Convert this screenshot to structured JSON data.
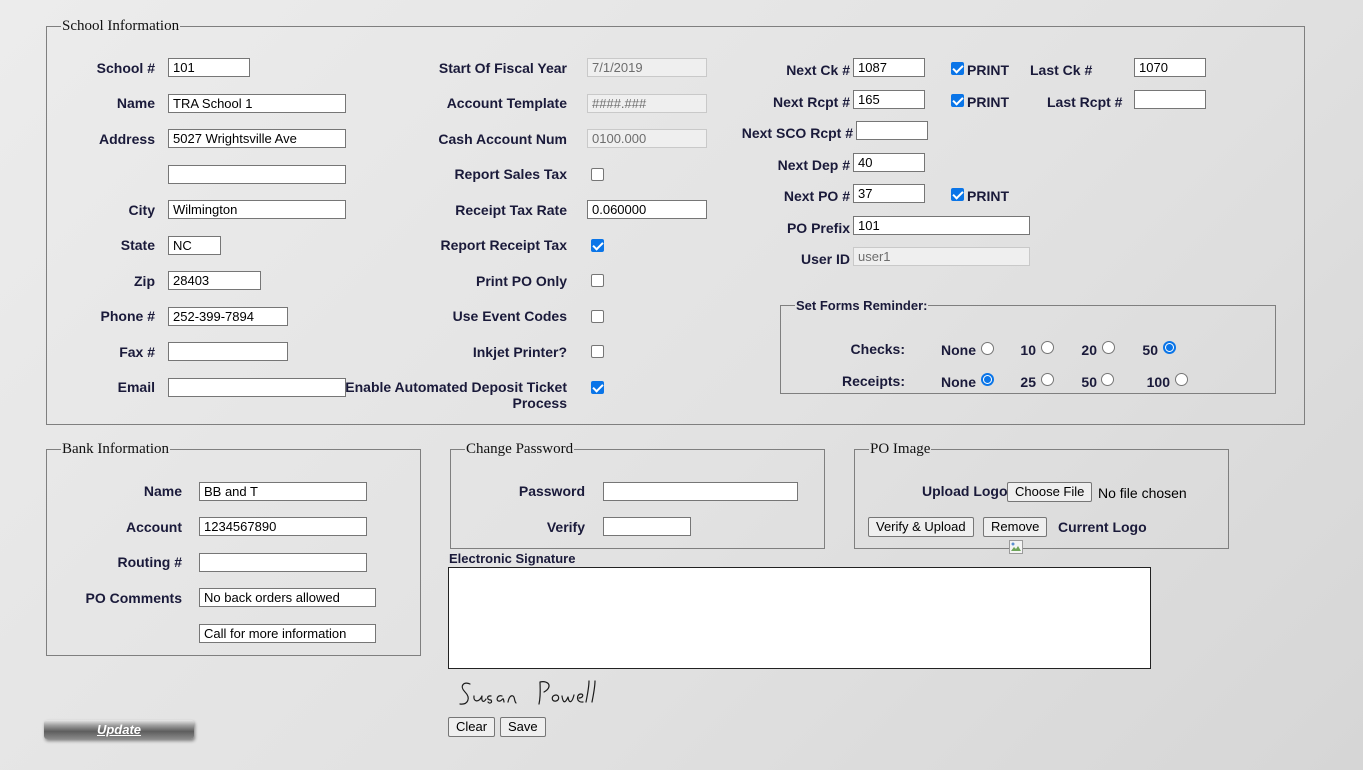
{
  "school": {
    "legend": "School Information",
    "labels": {
      "school_num": "School #",
      "name": "Name",
      "address": "Address",
      "city": "City",
      "state": "State",
      "zip": "Zip",
      "phone": "Phone #",
      "fax": "Fax #",
      "email": "Email"
    },
    "values": {
      "school_num": "101",
      "name": "TRA School 1",
      "address1": "5027 Wrightsville Ave",
      "address2": "",
      "city": "Wilmington",
      "state": "NC",
      "zip": "28403",
      "phone": "252-399-7894",
      "fax": "",
      "email": ""
    }
  },
  "fiscal": {
    "labels": {
      "start_fiscal": "Start Of Fiscal Year",
      "account_template": "Account Template",
      "cash_account": "Cash Account Num",
      "report_sales_tax": "Report Sales Tax",
      "receipt_tax_rate": "Receipt Tax Rate",
      "report_receipt_tax": "Report Receipt Tax",
      "print_po_only": "Print PO Only",
      "use_event_codes": "Use Event Codes",
      "inkjet_printer": "Inkjet Printer?",
      "enable_deposit_1": "Enable Automated Deposit Ticket",
      "enable_deposit_2": "Process"
    },
    "values": {
      "start_fiscal": "7/1/2019",
      "account_template": "####.###",
      "cash_account": "0100.000",
      "receipt_tax_rate": "0.060000"
    },
    "checks": {
      "report_sales_tax": false,
      "report_receipt_tax": true,
      "print_po_only": false,
      "use_event_codes": false,
      "inkjet_printer": false,
      "enable_deposit": true
    }
  },
  "numbers": {
    "labels": {
      "next_ck": "Next Ck #",
      "next_rcpt": "Next Rcpt #",
      "next_sco_rcpt": "Next SCO Rcpt #",
      "next_dep": "Next Dep #",
      "next_po": "Next PO #",
      "po_prefix": "PO Prefix",
      "user_id": "User ID",
      "last_ck": "Last Ck #",
      "last_rcpt": "Last Rcpt #",
      "print": "PRINT"
    },
    "values": {
      "next_ck": "1087",
      "next_rcpt": "165",
      "next_sco_rcpt": "",
      "next_dep": "40",
      "next_po": "37",
      "po_prefix": "101",
      "user_id": "user1",
      "last_ck": "1070",
      "last_rcpt": ""
    },
    "print_checks": {
      "ck": true,
      "rcpt": true,
      "po": true
    }
  },
  "reminder": {
    "legend": "Set Forms Reminder:",
    "checks_label": "Checks:",
    "receipts_label": "Receipts:",
    "checks_options": [
      "None",
      "10",
      "20",
      "50"
    ],
    "checks_selected": "50",
    "receipts_options": [
      "None",
      "25",
      "50",
      "100"
    ],
    "receipts_selected": "None"
  },
  "bank": {
    "legend": "Bank Information",
    "labels": {
      "name": "Name",
      "account": "Account",
      "routing": "Routing #",
      "po_comments": "PO Comments"
    },
    "values": {
      "name": "BB and T",
      "account": "1234567890",
      "routing": "",
      "po_comment_1": "No back orders allowed",
      "po_comment_2": "Call for more information"
    }
  },
  "password": {
    "legend": "Change Password",
    "password_label": "Password",
    "verify_label": "Verify",
    "password_value": "",
    "verify_value": ""
  },
  "po_image": {
    "legend": "PO Image",
    "upload_label": "Upload Logo",
    "choose_file": "Choose File",
    "no_file": "No file chosen",
    "verify_upload": "Verify & Upload",
    "remove": "Remove",
    "current_logo": "Current Logo"
  },
  "signature": {
    "label": "Electronic Signature",
    "signed_name": "Susan Powell",
    "clear": "Clear",
    "save": "Save"
  },
  "update_label": "Update"
}
